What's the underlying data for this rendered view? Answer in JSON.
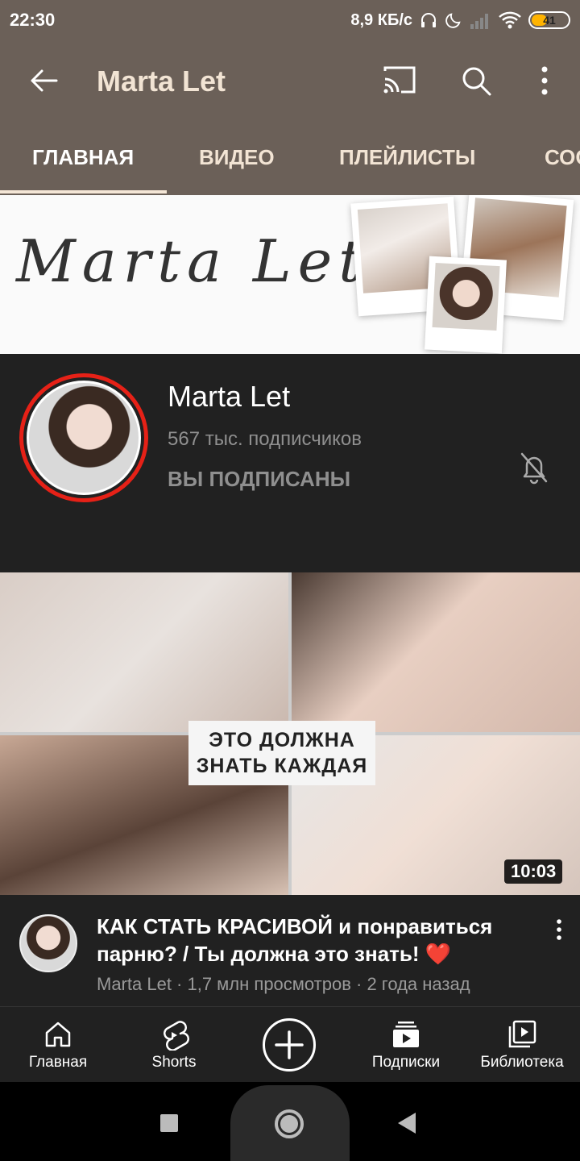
{
  "status_bar": {
    "time": "22:30",
    "net_speed": "8,9 КБ/с",
    "battery_level": "41"
  },
  "app_bar": {
    "title": "Marta Let"
  },
  "tabs": [
    {
      "label": "ГЛАВНАЯ",
      "active": true
    },
    {
      "label": "ВИДЕО",
      "active": false
    },
    {
      "label": "ПЛЕЙЛИСТЫ",
      "active": false
    },
    {
      "label": "СОО",
      "active": false
    }
  ],
  "banner": {
    "script_text": "Marta Let"
  },
  "channel": {
    "name": "Marta Let",
    "subscribers": "567 тыс. подписчиков",
    "subscribed_label": "ВЫ ПОДПИСАНЫ"
  },
  "video": {
    "thumbnail_caption_line1": "ЭТО ДОЛЖНА",
    "thumbnail_caption_line2": "ЗНАТЬ КАЖДАЯ",
    "duration": "10:03",
    "title": "КАК СТАТЬ КРАСИВОЙ и понравиться парню? / Ты должна это знать!",
    "title_emoji": "❤️",
    "meta": "Marta Let · 1,7 млн просмотров · 2 года назад"
  },
  "bottom_nav": {
    "home": "Главная",
    "shorts": "Shorts",
    "subscriptions": "Подписки",
    "library": "Библиотека"
  },
  "colors": {
    "app_bar": "#6b6058",
    "header_text": "#f2e4d4",
    "dark_surface": "#212121",
    "avatar_ring": "#e62117"
  }
}
